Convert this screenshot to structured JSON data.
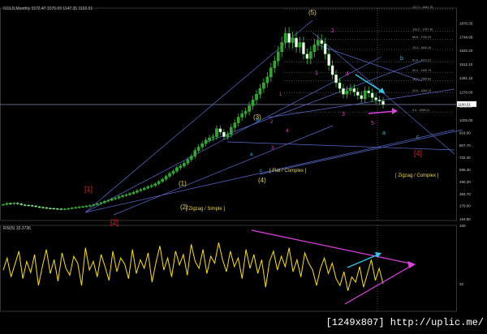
{
  "chart_data": [
    {
      "type": "candlestick",
      "symbol_header": "GOLD,Monthly 1572.47 1576.09 1147.35 1160.51",
      "ylim": [
        150,
        2000
      ],
      "y_ticks": [
        "1991.75",
        "1870.35",
        "1748.95",
        "1632.20",
        "1512.10",
        "1391.10",
        "1270.00",
        "1145.00",
        "1025.00",
        "916.00",
        "807.70",
        "702.30",
        "596.30",
        "490.30",
        "384.70",
        "279.00",
        "164.80"
      ],
      "fib_levels": [
        {
          "label": "127.2 - 1991.75",
          "price": 1991.75
        },
        {
          "label": "100.0 - 1797.30",
          "price": 1797.3
        },
        {
          "label": "88.6 - 1730.20",
          "price": 1730.2
        },
        {
          "label": "76.4 - 1640.10",
          "price": 1640.1
        },
        {
          "label": "61.8 - 1531.01",
          "price": 1531.01
        },
        {
          "label": "50.0 - 1440.74",
          "price": 1440.74
        },
        {
          "label": "38.2 - 1366.82",
          "price": 1366.82
        },
        {
          "label": "23.6 - 1264.13",
          "price": 1264.13
        },
        {
          "label": "0.0 - 1095.21",
          "price": 1095.21
        }
      ],
      "last_price": "1160.51",
      "series": [
        {
          "name": "Gold monthly close (approx.)",
          "values": [
            290,
            300,
            296,
            302,
            295,
            287,
            284,
            281,
            277,
            270,
            266,
            262,
            258,
            256,
            253,
            252,
            250,
            251,
            255,
            260,
            264,
            268,
            272,
            276,
            281,
            288,
            296,
            305,
            318,
            326,
            338,
            345,
            358,
            367,
            375,
            385,
            395,
            410,
            420,
            432,
            445,
            455,
            470,
            490,
            510,
            535,
            560,
            580,
            610,
            625,
            650,
            680,
            710,
            760,
            790,
            820,
            850,
            870,
            880,
            950,
            920,
            880,
            900,
            960,
            1000,
            1050,
            1080,
            1100,
            1150,
            1200,
            1250,
            1300,
            1350,
            1400,
            1480,
            1540,
            1620,
            1700,
            1780,
            1700,
            1740,
            1660,
            1700,
            1600,
            1560,
            1620,
            1680,
            1720,
            1690,
            1600,
            1500,
            1420,
            1350,
            1300,
            1250,
            1280,
            1300,
            1270,
            1240,
            1210,
            1280,
            1260,
            1220,
            1200,
            1190,
            1160
          ]
        }
      ],
      "wave_labels": [
        "(1)",
        "(2)",
        "(3)",
        "(4)",
        "(5)",
        "[1]",
        "[2]",
        "[4]",
        "1",
        "2",
        "3",
        "4",
        "5",
        "a",
        "b",
        "c",
        "[ Zigzag / Simple ]",
        "[ Flat / Complex ]",
        "[ Zigzag / Complex ]"
      ]
    },
    {
      "type": "line",
      "title": "RSI(5) 33.3736",
      "ylim": [
        0,
        100
      ],
      "y_ticks": [
        "100",
        "32"
      ],
      "series": [
        {
          "name": "RSI(5)",
          "values": [
            48,
            62,
            40,
            55,
            70,
            38,
            58,
            45,
            66,
            30,
            52,
            72,
            44,
            60,
            35,
            68,
            50,
            42,
            64,
            56,
            30,
            74,
            48,
            58,
            40,
            66,
            52,
            36,
            70,
            46,
            62,
            55,
            38,
            72,
            44,
            60,
            50,
            68,
            34,
            57,
            76,
            48,
            62,
            40,
            70,
            54,
            66,
            42,
            78,
            58,
            50,
            72,
            44,
            64,
            56,
            80,
            60,
            46,
            70,
            52,
            62,
            38,
            72,
            50,
            66,
            44,
            60,
            28,
            58,
            70,
            48,
            64,
            52,
            74,
            46,
            60,
            40,
            68,
            56,
            48,
            30,
            50,
            62,
            44,
            56,
            38,
            30,
            46,
            24,
            40,
            34,
            52,
            28,
            44,
            60,
            36,
            50,
            32
          ]
        }
      ]
    }
  ],
  "caption": "[1249x807] http://uplic.me/"
}
